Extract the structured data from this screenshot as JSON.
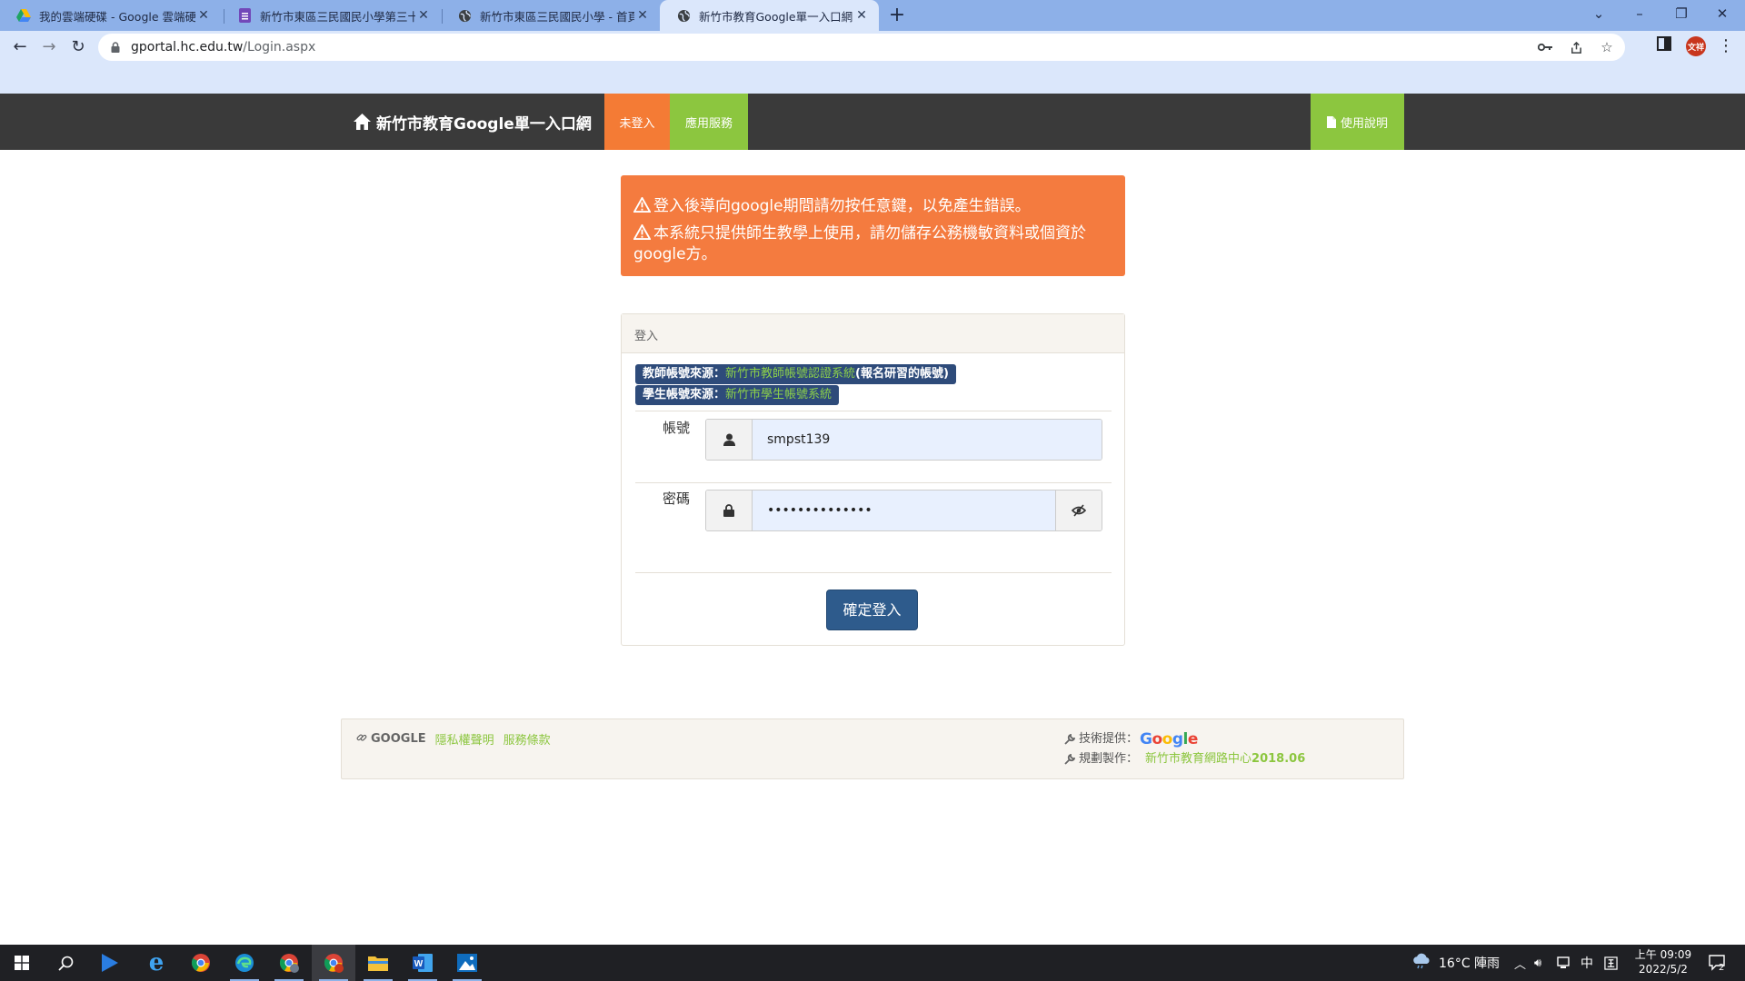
{
  "browser": {
    "tabs": [
      {
        "title": "我的雲端硬碟 - Google 雲端硬碟",
        "icon": "google-drive-icon"
      },
      {
        "title": "新竹市東區三民國民小學第三十二",
        "icon": "google-forms-icon"
      },
      {
        "title": "新竹市東區三民國民小學 - 首頁",
        "icon": "globe-icon"
      },
      {
        "title": "新竹市教育Google單一入口網",
        "icon": "globe-icon",
        "active": true
      }
    ],
    "url_host": "gportal.hc.edu.tw",
    "url_path": "/Login.aspx",
    "profile_initials": "文祥"
  },
  "header": {
    "brand": "新竹市教育Google單一入口網",
    "nav_login": "未登入",
    "nav_apps": "應用服務",
    "nav_help": "使用說明"
  },
  "alert": {
    "line1": "登入後導向google期間請勿按任意鍵，以免產生錯誤。",
    "line2": "本系統只提供師生教學上使用，請勿儲存公務機敏資料或個資於google方。"
  },
  "login": {
    "panel_title": "登入",
    "teacher_source_label": "教師帳號來源：",
    "teacher_source_link": "新竹市教師帳號認證系統",
    "teacher_source_note": "(報名研習的帳號)",
    "student_source_label": "學生帳號來源：",
    "student_source_link": "新竹市學生帳號系統",
    "account_label": "帳號",
    "account_value": "smpst139",
    "password_label": "密碼",
    "password_value": "••••••••••••••",
    "submit": "確定登入"
  },
  "footer": {
    "google_label": "GOOGLE",
    "privacy": "隱私權聲明",
    "terms": "服務條款",
    "tech_label": "技術提供：",
    "tech_brand": "Google",
    "planner_label": "規劃製作：",
    "planner_name": "新竹市教育網路中心",
    "planner_year": "2018.06"
  },
  "taskbar": {
    "weather": "16°C 陣雨",
    "ime": "中",
    "time": "上午 09:09",
    "date": "2022/5/2",
    "notifications": "2"
  },
  "colors": {
    "orange": "#f47b35",
    "green": "#8cc63f",
    "navy": "#2e5b8c",
    "header_bg": "#3a3a3a"
  }
}
